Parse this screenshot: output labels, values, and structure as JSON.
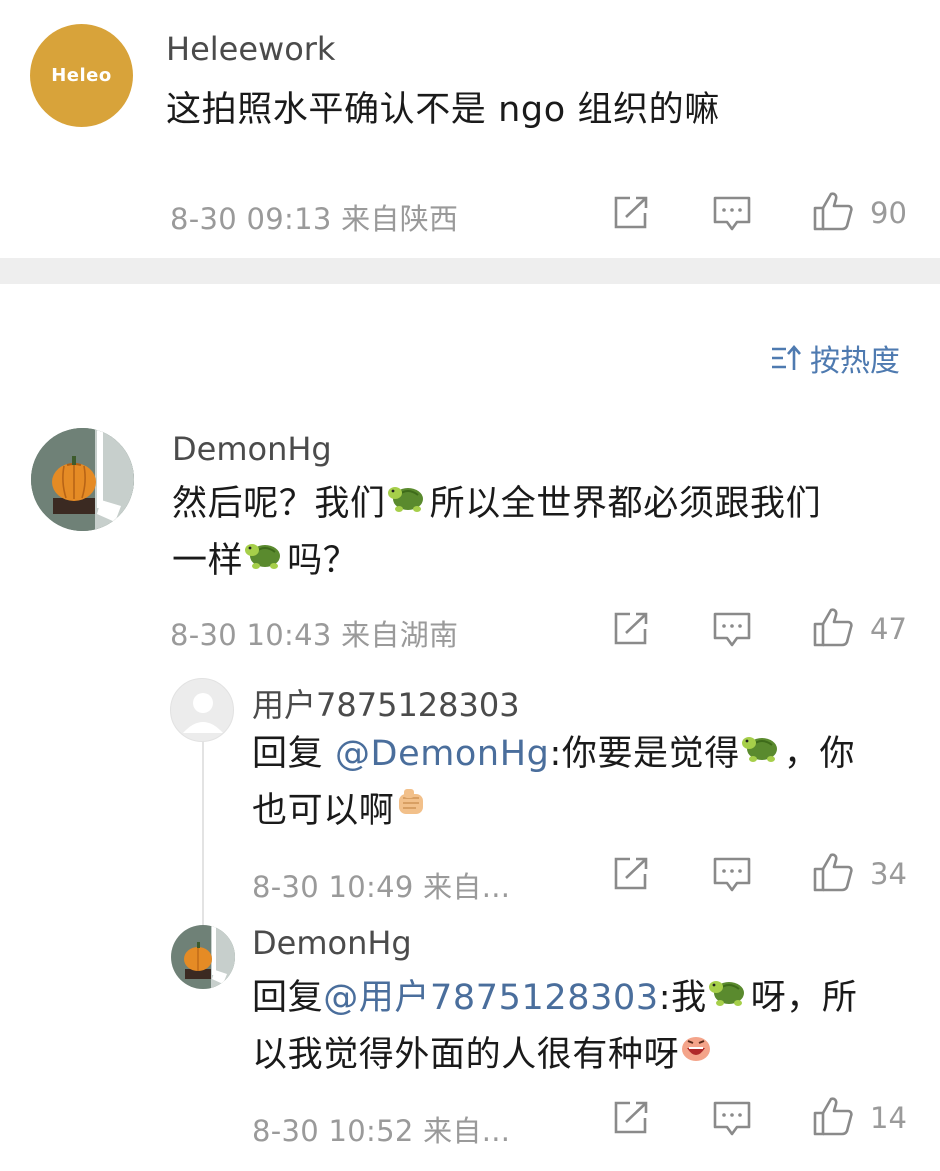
{
  "comment1": {
    "avatar_text": "Heleo",
    "username": "Heleework",
    "text": "这拍照水平确认不是 ngo 组织的嘛",
    "meta": "8-30 09:13 来自陕西",
    "likes": "90"
  },
  "sort": {
    "label": "按热度"
  },
  "comment2": {
    "username": "DemonHg",
    "text_line1_a": "然后呢？我们",
    "text_line1_b": "所以全世界都必须跟我们",
    "text_line2_a": "一样",
    "text_line2_b": "吗？",
    "meta": "8-30 10:43 来自湖南",
    "likes": "47"
  },
  "reply1": {
    "username": "用户7875128303",
    "prefix": "回复 ",
    "mention": "@DemonHg",
    "text_line1_a": ":你要是觉得",
    "text_line1_b": "，你",
    "text_line2": "也可以啊",
    "meta": "8-30 10:49 来自...",
    "likes": "34"
  },
  "reply2": {
    "username": "DemonHg",
    "prefix": "回复",
    "mention": "@用户7875128303",
    "text_line1_a": ":我",
    "text_line1_b": "呀，所",
    "text_line2": "以我觉得外面的人很有种呀",
    "meta": "8-30 10:52 来自...",
    "likes": "14"
  },
  "colors": {
    "accent": "#4e7ab0",
    "mention": "#4a6e9c",
    "meta": "#9a9a9a",
    "divider": "#eeeeee",
    "avatar_heleework": "#d8a33a"
  },
  "icons": [
    "share-icon",
    "comment-icon",
    "like-icon",
    "sort-icon",
    "turtle-emoji",
    "fist-emoji",
    "laugh-emoji"
  ]
}
